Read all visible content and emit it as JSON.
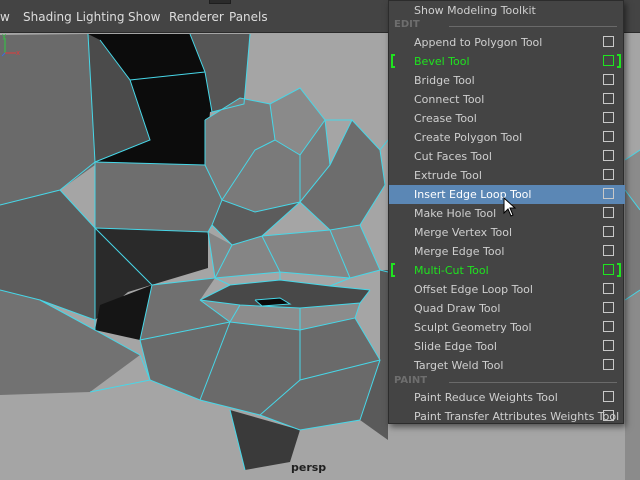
{
  "menubar": {
    "items": [
      "w",
      "Shading",
      "Lighting",
      "Show",
      "Renderer",
      "Panels"
    ]
  },
  "viewport": {
    "camera_label": "persp",
    "wire_color": "#47d7e8"
  },
  "menu": {
    "top_item": "Show Modeling Toolkit",
    "section_edit": "EDIT",
    "edit_items": [
      {
        "label": "Append to Polygon Tool"
      },
      {
        "label": "Bevel Tool",
        "active": true
      },
      {
        "label": "Bridge Tool"
      },
      {
        "label": "Connect Tool"
      },
      {
        "label": "Crease Tool"
      },
      {
        "label": "Create Polygon Tool"
      },
      {
        "label": "Cut Faces Tool"
      },
      {
        "label": "Extrude Tool"
      },
      {
        "label": "Insert Edge Loop Tool",
        "highlighted": true
      },
      {
        "label": "Make Hole Tool"
      },
      {
        "label": "Merge Vertex Tool"
      },
      {
        "label": "Merge Edge Tool"
      },
      {
        "label": "Multi-Cut Tool",
        "active": true
      },
      {
        "label": "Offset Edge Loop Tool"
      },
      {
        "label": "Quad Draw Tool"
      },
      {
        "label": "Sculpt Geometry Tool"
      },
      {
        "label": "Slide Edge Tool"
      },
      {
        "label": "Target Weld Tool"
      }
    ],
    "section_paint": "PAINT",
    "paint_items": [
      {
        "label": "Paint Reduce Weights Tool"
      },
      {
        "label": "Paint Transfer Attributes Weights Tool"
      }
    ],
    "highlight_color": "#5b87b5",
    "active_color": "#1fe41f"
  }
}
